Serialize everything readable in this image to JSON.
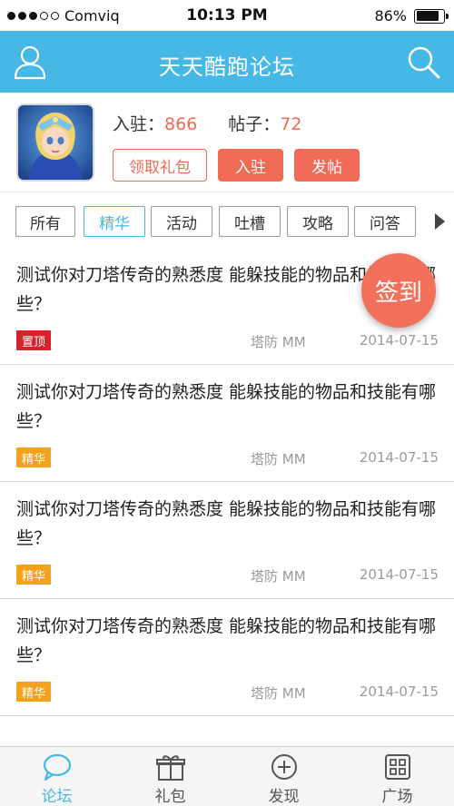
{
  "status_bar": {
    "carrier": "Comviq",
    "time": "10:13 PM",
    "battery": "86%",
    "battery_level": 0.86
  },
  "header": {
    "title": "天天酷跑论坛",
    "user_icon": "user-icon",
    "search_icon": "search-icon"
  },
  "profile": {
    "join_label": "入驻：",
    "join_count": "866",
    "posts_label": "帖子：",
    "posts_count": "72",
    "gift_button": "领取礼包",
    "join_button": "入驻",
    "post_button": "发帖"
  },
  "tabs": [
    "所有",
    "精华",
    "活动",
    "吐槽",
    "攻略",
    "问答"
  ],
  "active_tab": "精华",
  "signin_label": "签到",
  "posts": [
    {
      "title": "测试你对刀塔传奇的熟悉度  能躲技能的物品和技能有哪些？",
      "badge": "置顶",
      "badge_color": "#d8222b",
      "author": "塔防 MM",
      "date": "2014-07-15"
    },
    {
      "title": "测试你对刀塔传奇的熟悉度  能躲技能的物品和技能有哪些？",
      "badge": "精华",
      "badge_color": "#f5a11c",
      "author": "塔防 MM",
      "date": "2014-07-15"
    },
    {
      "title": "测试你对刀塔传奇的熟悉度  能躲技能的物品和技能有哪些？",
      "badge": "精华",
      "badge_color": "#f5a11c",
      "author": "塔防 MM",
      "date": "2014-07-15"
    },
    {
      "title": "测试你对刀塔传奇的熟悉度  能躲技能的物品和技能有哪些？",
      "badge": "精华",
      "badge_color": "#f5a11c",
      "author": "塔防 MM",
      "date": "2014-07-15"
    }
  ],
  "bottom_nav": [
    {
      "label": "论坛",
      "icon": "chat-bubble-icon"
    },
    {
      "label": "礼包",
      "icon": "gift-icon"
    },
    {
      "label": "发现",
      "icon": "plus-circle-icon"
    },
    {
      "label": "广场",
      "icon": "grid-icon"
    }
  ],
  "colors": {
    "accent": "#45b8e6",
    "highlight": "#f06b55",
    "top_badge": "#d8222b",
    "featured_badge": "#f5a11c"
  }
}
